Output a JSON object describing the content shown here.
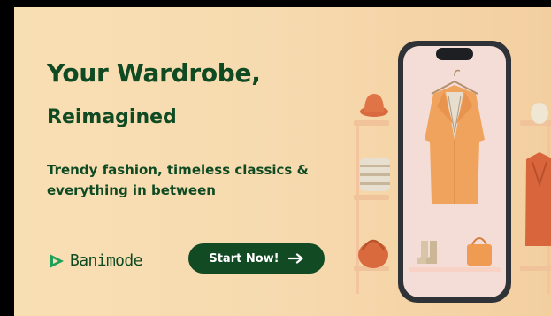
{
  "headline": {
    "line1": "Your Wardrobe,",
    "line2": "Reimagined"
  },
  "tagline": "Trendy fashion, timeless classics & everything in between",
  "brand": {
    "name": "Banimode",
    "logo_icon": "play-badge-icon",
    "color": "#0f4a23"
  },
  "cta": {
    "label": "Start Now!",
    "icon": "arrow-right-icon",
    "bg_color": "#124a24"
  },
  "colors": {
    "background": "#f8dfb3",
    "text": "#0f4a23"
  }
}
